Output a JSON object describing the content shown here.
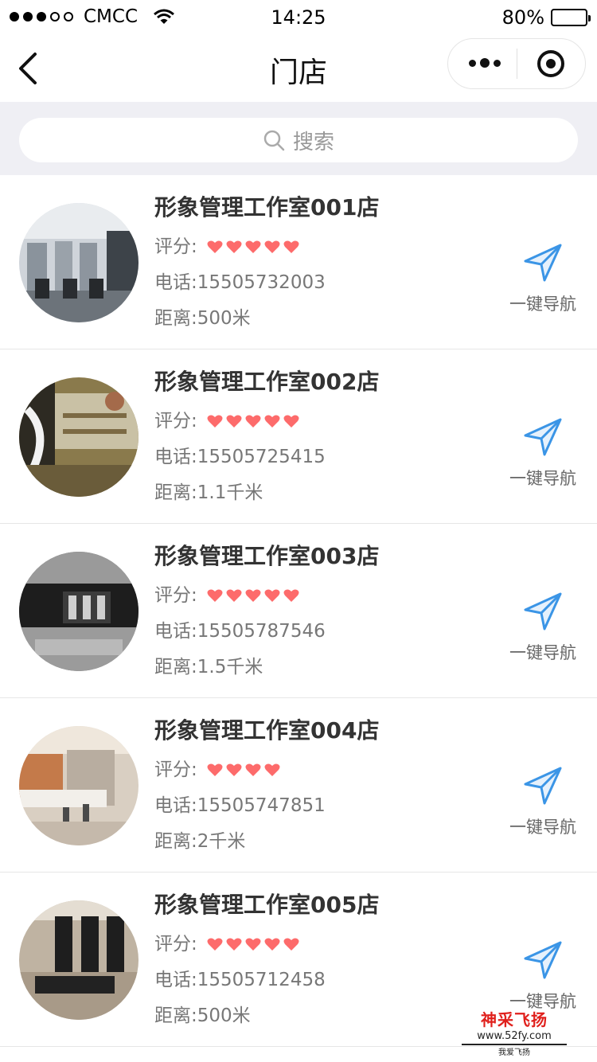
{
  "status_bar": {
    "carrier": "CMCC",
    "time": "14:25",
    "battery": "80%",
    "battery_level": 0.8
  },
  "nav": {
    "title": "门店"
  },
  "search": {
    "placeholder": "搜索"
  },
  "labels": {
    "rating": "评分:",
    "navigate": "一键导航"
  },
  "colors": {
    "heart": "#fd6b6b",
    "nav_icon": "#3b95e6",
    "search_bg": "#efeff4"
  },
  "stores": [
    {
      "name": "形象管理工作室001店",
      "rating": 5,
      "phone": "电话:15505732003",
      "distance": "距离:500米"
    },
    {
      "name": "形象管理工作室002店",
      "rating": 5,
      "phone": "电话:15505725415",
      "distance": "距离:1.1千米"
    },
    {
      "name": "形象管理工作室003店",
      "rating": 5,
      "phone": "电话:15505787546",
      "distance": "距离:1.5千米"
    },
    {
      "name": "形象管理工作室004店",
      "rating": 4,
      "phone": "电话:15505747851",
      "distance": "距离:2千米"
    },
    {
      "name": "形象管理工作室005店",
      "rating": 5,
      "phone": "电话:15505712458",
      "distance": "距离:500米"
    }
  ],
  "watermark": {
    "title": "神采飞扬",
    "url": "www.52fy.com",
    "sub": "我爱飞扬"
  }
}
